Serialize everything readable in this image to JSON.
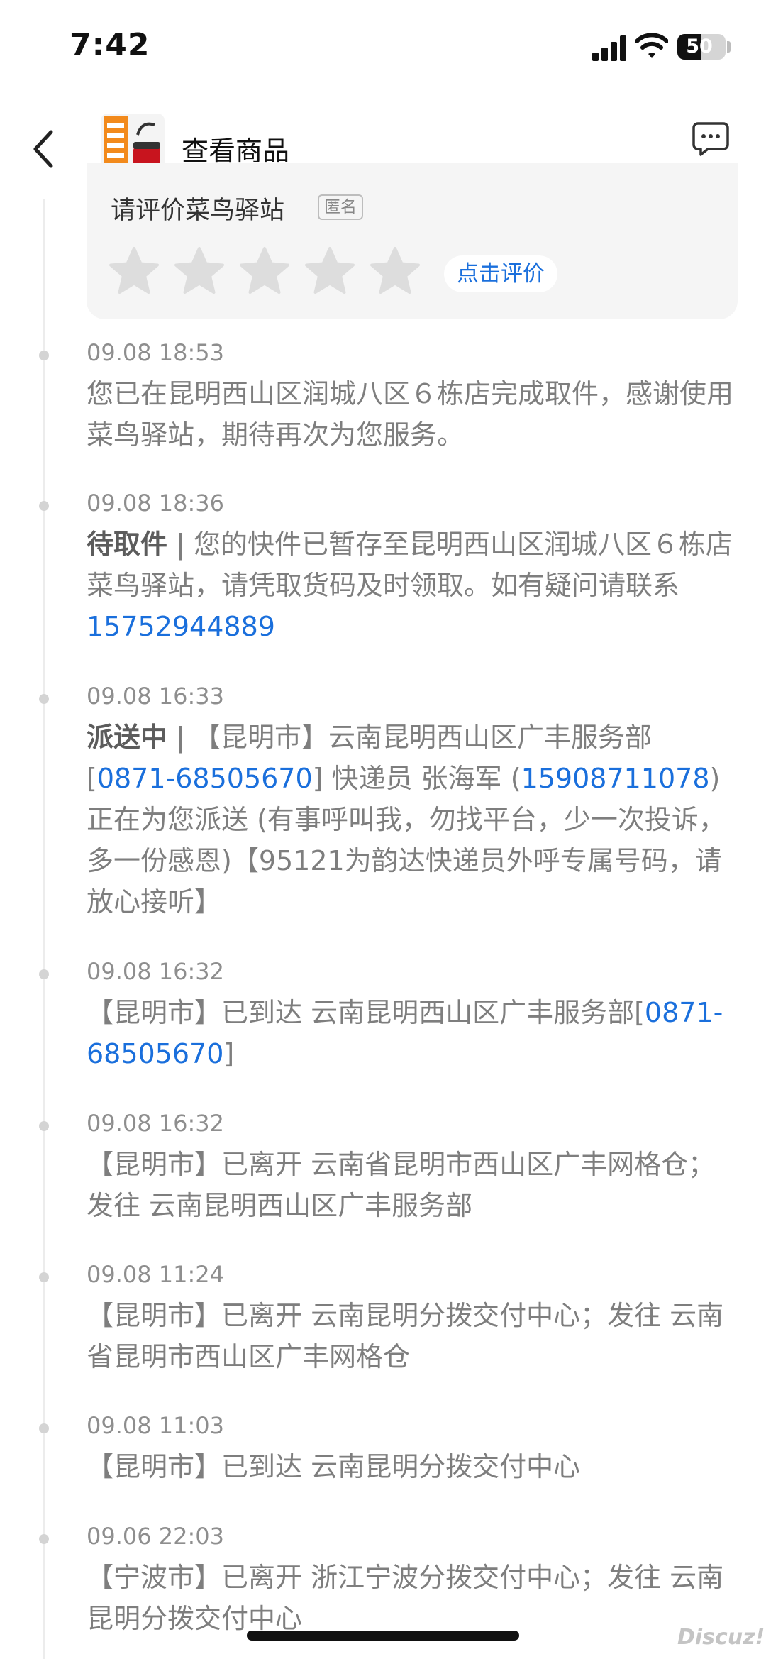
{
  "status_bar": {
    "time": "7:42",
    "battery": "50",
    "battery_level": 0.5
  },
  "header": {
    "title": "查看商品",
    "service_label": "客服"
  },
  "rating_card": {
    "title": "请评价菜鸟驿站",
    "anonymous_badge": "匿名",
    "star_count": 5,
    "rate_button": "点击评价"
  },
  "entries": [
    {
      "time": "09.08 18:53",
      "text": "您已在昆明西山区润城八区６栋店完成取件，感谢使用菜鸟驿站，期待再次为您服务。"
    },
    {
      "time": "09.08 18:36",
      "status": "待取件",
      "separator": " | ",
      "text_before": "您的快件已暂存至昆明西山区润城八区６栋店菜鸟驿站，请凭取货码及时领取。如有疑问请联系",
      "phone": "15752944889"
    },
    {
      "time": "09.08 16:33",
      "status": "派送中",
      "separator": " | ",
      "text_before": "【昆明市】云南昆明西山区广丰服务部[",
      "phone1": "0871-68505670",
      "text_mid": "] 快递员 张海军 (",
      "phone2": "15908711078",
      "text_after": ") 正在为您派送 (有事呼叫我，勿找平台，少一次投诉，多一份感恩)【95121为韵达快递员外呼专属号码，请放心接听】"
    },
    {
      "time": "09.08 16:32",
      "text_before": "【昆明市】已到达 云南昆明西山区广丰服务部[",
      "phone": "0871-68505670",
      "text_after": "]"
    },
    {
      "time": "09.08 16:32",
      "text": "【昆明市】已离开 云南省昆明市西山区广丰网格仓；发往 云南昆明西山区广丰服务部"
    },
    {
      "time": "09.08 11:24",
      "text": "【昆明市】已离开 云南昆明分拨交付中心；发往 云南省昆明市西山区广丰网格仓"
    },
    {
      "time": "09.08 11:03",
      "text": "【昆明市】已到达 云南昆明分拨交付中心"
    },
    {
      "time": "09.06 22:03",
      "text": "【宁波市】已离开 浙江宁波分拨交付中心；发往 云南昆明分拨交付中心"
    }
  ],
  "watermark": "Discuz!",
  "colors": {
    "link": "#1a6fdc",
    "star": "#dddddd",
    "card_bg": "#f5f5f5"
  },
  "icons": [
    "back-arrow-icon",
    "service-chat-icon",
    "star-icon",
    "signal-icon",
    "wifi-icon",
    "battery-icon"
  ]
}
